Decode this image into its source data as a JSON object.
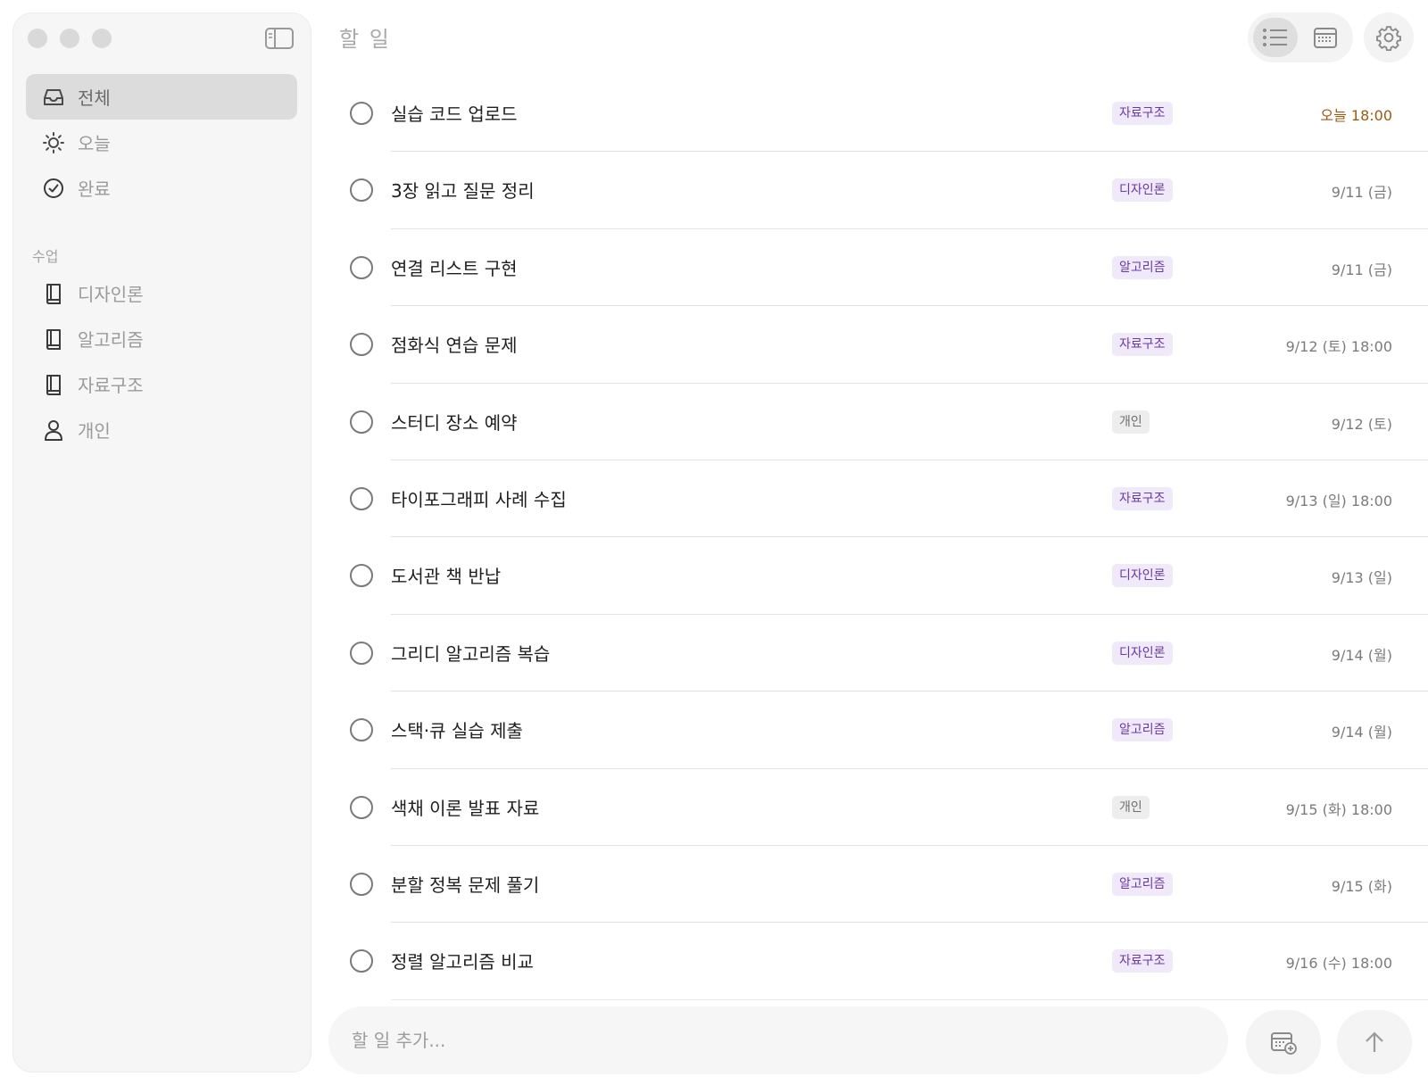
{
  "sidebar": {
    "main_items": [
      {
        "label": "전체",
        "icon": "inbox-icon",
        "active": true
      },
      {
        "label": "오늘",
        "icon": "sun-icon",
        "active": false
      },
      {
        "label": "완료",
        "icon": "check-circle-icon",
        "active": false
      }
    ],
    "section_label": "수업",
    "class_items": [
      {
        "label": "디자인론",
        "icon": "book-icon"
      },
      {
        "label": "알고리즘",
        "icon": "book-icon"
      },
      {
        "label": "자료구조",
        "icon": "book-icon"
      },
      {
        "label": "개인",
        "icon": "person-icon"
      }
    ]
  },
  "header": {
    "title": "할 일"
  },
  "tasks": [
    {
      "title": "실습 코드 업로드",
      "tag": "자료구조",
      "tag_style": "purple",
      "due": "오늘 18:00",
      "due_today": true
    },
    {
      "title": "3장 읽고 질문 정리",
      "tag": "디자인론",
      "tag_style": "purple",
      "due": "9/11 (금)"
    },
    {
      "title": "연결 리스트 구현",
      "tag": "알고리즘",
      "tag_style": "purple",
      "due": "9/11 (금)"
    },
    {
      "title": "점화식 연습 문제",
      "tag": "자료구조",
      "tag_style": "purple",
      "due": "9/12 (토) 18:00"
    },
    {
      "title": "스터디 장소 예약",
      "tag": "개인",
      "tag_style": "gray",
      "due": "9/12 (토)"
    },
    {
      "title": "타이포그래피 사례 수집",
      "tag": "자료구조",
      "tag_style": "purple",
      "due": "9/13 (일) 18:00"
    },
    {
      "title": "도서관 책 반납",
      "tag": "디자인론",
      "tag_style": "purple",
      "due": "9/13 (일)"
    },
    {
      "title": "그리디 알고리즘 복습",
      "tag": "디자인론",
      "tag_style": "purple",
      "due": "9/14 (월)"
    },
    {
      "title": "스택·큐 실습 제출",
      "tag": "알고리즘",
      "tag_style": "purple",
      "due": "9/14 (월)"
    },
    {
      "title": "색채 이론 발표 자료",
      "tag": "개인",
      "tag_style": "gray",
      "due": "9/15 (화) 18:00"
    },
    {
      "title": "분할 정복 문제 풀기",
      "tag": "알고리즘",
      "tag_style": "purple",
      "due": "9/15 (화)"
    },
    {
      "title": "정렬 알고리즘 비교",
      "tag": "자료구조",
      "tag_style": "purple",
      "due": "9/16 (수) 18:00"
    }
  ],
  "composer": {
    "placeholder": "할 일 추가..."
  },
  "colors": {
    "accent_tag_bg": "#efe9f9",
    "accent_tag_text": "#6a3aa4",
    "today_due": "#9b5a12"
  }
}
